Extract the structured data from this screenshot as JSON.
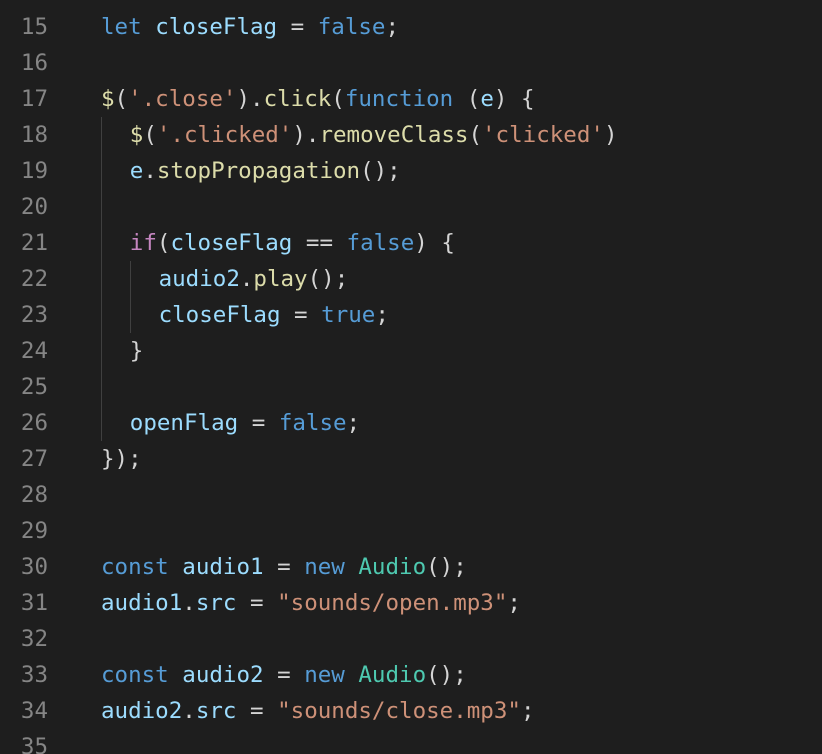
{
  "editor": {
    "language": "javascript",
    "lines": [
      {
        "number": "15",
        "indent": 0,
        "tokens": [
          [
            "let",
            "kw"
          ],
          [
            " ",
            "op"
          ],
          [
            "closeFlag",
            "var"
          ],
          [
            " = ",
            "op"
          ],
          [
            "false",
            "kw"
          ],
          [
            ";",
            "op"
          ]
        ]
      },
      {
        "number": "16",
        "indent": 0,
        "tokens": []
      },
      {
        "number": "17",
        "indent": 0,
        "tokens": [
          [
            "$",
            "fn"
          ],
          [
            "(",
            "op"
          ],
          [
            "'.close'",
            "str"
          ],
          [
            ").",
            "op"
          ],
          [
            "click",
            "fn"
          ],
          [
            "(",
            "op"
          ],
          [
            "function",
            "kw"
          ],
          [
            " (",
            "op"
          ],
          [
            "e",
            "var"
          ],
          [
            ") {",
            "op"
          ]
        ]
      },
      {
        "number": "18",
        "indent": 1,
        "tokens": [
          [
            "$",
            "fn"
          ],
          [
            "(",
            "op"
          ],
          [
            "'.clicked'",
            "str"
          ],
          [
            ").",
            "op"
          ],
          [
            "removeClass",
            "fn"
          ],
          [
            "(",
            "op"
          ],
          [
            "'clicked'",
            "str"
          ],
          [
            ")",
            "op"
          ]
        ]
      },
      {
        "number": "19",
        "indent": 1,
        "tokens": [
          [
            "e",
            "var"
          ],
          [
            ".",
            "op"
          ],
          [
            "stopPropagation",
            "fn"
          ],
          [
            "();",
            "op"
          ]
        ]
      },
      {
        "number": "20",
        "indent": 0,
        "tokens": []
      },
      {
        "number": "21",
        "indent": 1,
        "tokens": [
          [
            "if",
            "ctl"
          ],
          [
            "(",
            "op"
          ],
          [
            "closeFlag",
            "var"
          ],
          [
            " == ",
            "op"
          ],
          [
            "false",
            "kw"
          ],
          [
            ") {",
            "op"
          ]
        ]
      },
      {
        "number": "22",
        "indent": 2,
        "tokens": [
          [
            "audio2",
            "var"
          ],
          [
            ".",
            "op"
          ],
          [
            "play",
            "fn"
          ],
          [
            "();",
            "op"
          ]
        ]
      },
      {
        "number": "23",
        "indent": 2,
        "tokens": [
          [
            "closeFlag",
            "var"
          ],
          [
            " = ",
            "op"
          ],
          [
            "true",
            "kw"
          ],
          [
            ";",
            "op"
          ]
        ]
      },
      {
        "number": "24",
        "indent": 1,
        "tokens": [
          [
            "}",
            "op"
          ]
        ]
      },
      {
        "number": "25",
        "indent": 0,
        "tokens": []
      },
      {
        "number": "26",
        "indent": 1,
        "tokens": [
          [
            "openFlag",
            "var"
          ],
          [
            " = ",
            "op"
          ],
          [
            "false",
            "kw"
          ],
          [
            ";",
            "op"
          ]
        ]
      },
      {
        "number": "27",
        "indent": 0,
        "tokens": [
          [
            "});",
            "op"
          ]
        ]
      },
      {
        "number": "28",
        "indent": 0,
        "tokens": []
      },
      {
        "number": "29",
        "indent": 0,
        "tokens": []
      },
      {
        "number": "30",
        "indent": 0,
        "tokens": [
          [
            "const",
            "kw"
          ],
          [
            " ",
            "op"
          ],
          [
            "audio1",
            "var"
          ],
          [
            " = ",
            "op"
          ],
          [
            "new",
            "kw"
          ],
          [
            " ",
            "op"
          ],
          [
            "Audio",
            "cls"
          ],
          [
            "();",
            "op"
          ]
        ]
      },
      {
        "number": "31",
        "indent": 0,
        "tokens": [
          [
            "audio1",
            "var"
          ],
          [
            ".",
            "op"
          ],
          [
            "src",
            "var"
          ],
          [
            " = ",
            "op"
          ],
          [
            "\"sounds/open.mp3\"",
            "str"
          ],
          [
            ";",
            "op"
          ]
        ]
      },
      {
        "number": "32",
        "indent": 0,
        "tokens": []
      },
      {
        "number": "33",
        "indent": 0,
        "tokens": [
          [
            "const",
            "kw"
          ],
          [
            " ",
            "op"
          ],
          [
            "audio2",
            "var"
          ],
          [
            " = ",
            "op"
          ],
          [
            "new",
            "kw"
          ],
          [
            " ",
            "op"
          ],
          [
            "Audio",
            "cls"
          ],
          [
            "();",
            "op"
          ]
        ]
      },
      {
        "number": "34",
        "indent": 0,
        "tokens": [
          [
            "audio2",
            "var"
          ],
          [
            ".",
            "op"
          ],
          [
            "src",
            "var"
          ],
          [
            " = ",
            "op"
          ],
          [
            "\"sounds/close.mp3\"",
            "str"
          ],
          [
            ";",
            "op"
          ]
        ]
      },
      {
        "number": "35",
        "indent": 0,
        "tokens": []
      }
    ],
    "indent_guides": [
      {
        "level": 1,
        "from_line": "18",
        "to_line": "26"
      },
      {
        "level": 2,
        "from_line": "22",
        "to_line": "23"
      }
    ]
  },
  "colors": {
    "background": "#1e1e1e",
    "line_number": "#858585",
    "keyword": "#569cd6",
    "variable": "#9cdcfe",
    "string": "#ce9178",
    "function": "#dcdcaa",
    "control": "#c586c0",
    "class": "#4ec9b0",
    "text": "#d4d4d4"
  }
}
